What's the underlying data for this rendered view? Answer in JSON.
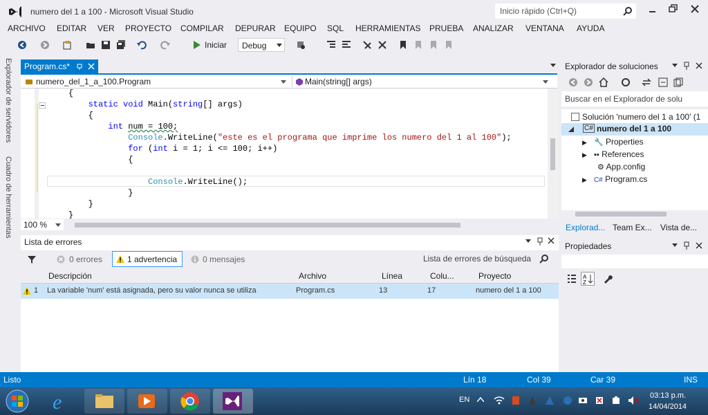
{
  "window": {
    "title": "numero del 1 a 100 - Microsoft Visual Studio",
    "quick_launch_placeholder": "Inicio rápido (Ctrl+Q)"
  },
  "menu": [
    "ARCHIVO",
    "EDITAR",
    "VER",
    "PROYECTO",
    "COMPILAR",
    "DEPURAR",
    "EQUIPO",
    "SQL",
    "HERRAMIENTAS",
    "PRUEBA",
    "ANALIZAR",
    "VENTANA",
    "AYUDA"
  ],
  "toolbar": {
    "start_label": "Iniciar",
    "config_value": "Debug"
  },
  "side_tabs": {
    "servers": "Explorador de servidores",
    "toolbox": "Cuadro de herramientas"
  },
  "editor": {
    "tab_label": "Program.cs*",
    "nav_class": "numero_del_1_a_100.Program",
    "nav_member": "Main(string[] args)",
    "zoom": "100 %",
    "lines": [
      {
        "indent": "    ",
        "text": "{"
      },
      {
        "indent": "        ",
        "kw": "static void ",
        "text": "Main(",
        "kw2": "string",
        "text2": "[] args)"
      },
      {
        "indent": "        ",
        "text": "{"
      },
      {
        "indent": "            ",
        "kw": "int ",
        "text": "num = 100;"
      },
      {
        "indent": "                ",
        "ty": "Console",
        "text": ".WriteLine(",
        "str": "\"este es el programa que imprime los numero del 1 al 100\"",
        "text2": ");"
      },
      {
        "indent": "                ",
        "kw": "for ",
        "text": "(",
        "kw2": "int ",
        "text2": "i = 1; i <= 100; i++)"
      },
      {
        "indent": "                ",
        "text": "{"
      },
      {
        "indent": "",
        "text": ""
      },
      {
        "indent": "                    ",
        "ty": "Console",
        "text": ".WriteLine();"
      },
      {
        "indent": "                ",
        "text": "}"
      },
      {
        "indent": "        ",
        "text": "}"
      },
      {
        "indent": "    ",
        "text": "}"
      }
    ]
  },
  "errors_panel": {
    "title": "Lista de errores",
    "filter_errors": "0 errores",
    "filter_warnings": "1 advertencia",
    "filter_messages": "0 mensajes",
    "search_placeholder": "Lista de errores de búsqueda",
    "columns": [
      "Descripción",
      "Archivo",
      "Línea",
      "Colu...",
      "Proyecto"
    ],
    "rows": [
      {
        "num": "1",
        "description": "La variable 'num' está asignada, pero su valor nunca se utiliza",
        "file": "Program.cs",
        "line": "13",
        "column": "17",
        "project": "numero del 1 a 100"
      }
    ]
  },
  "solution_explorer": {
    "title": "Explorador de soluciones",
    "search_placeholder": "Buscar en el Explorador de solu",
    "solution_label": "Solución 'numero del 1 a 100' (1",
    "project_label": "numero del 1 a 100",
    "items": [
      "Properties",
      "References",
      "App.config",
      "Program.cs"
    ],
    "tabs": [
      "Explorad...",
      "Team Ex...",
      "Vista de..."
    ]
  },
  "properties": {
    "title": "Propiedades"
  },
  "status": {
    "ready": "Listo",
    "line": "Lín 18",
    "col": "Col 39",
    "char": "Car 39",
    "mode": "INS"
  },
  "taskbar": {
    "lang": "EN",
    "time": "03:13 p.m.",
    "date": "14/04/2014"
  },
  "colors": {
    "accent": "#007acc",
    "keyword": "#0000ff",
    "type": "#2b91af",
    "string": "#a31515",
    "warning": "#f0c800"
  }
}
